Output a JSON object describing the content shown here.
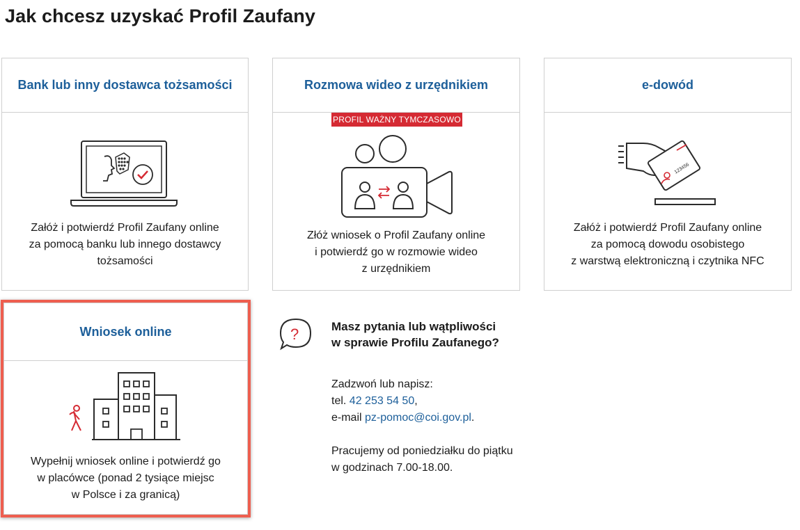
{
  "page": {
    "title": "Jak chcesz uzyskać Profil Zaufany"
  },
  "cards": [
    {
      "title": "Bank lub inny dostawca tożsamości",
      "description": [
        "Załóż i potwierdź Profil Zaufany online",
        "za pomocą banku lub innego dostawcy",
        "tożsamości"
      ],
      "icon": "laptop-identity-icon"
    },
    {
      "title": "Rozmowa wideo z urzędnikiem",
      "badge": "PROFIL WAŻNY TYMCZASOWO",
      "description": [
        "Złóż wniosek o Profil Zaufany online",
        "i potwierdź go w rozmowie wideo",
        "z urzędnikiem"
      ],
      "icon": "video-call-icon"
    },
    {
      "title": "e-dowód",
      "description": [
        "Załóż i potwierdź Profil Zaufany online",
        "za pomocą dowodu osobistego",
        "z warstwą elektroniczną i czytnika NFC"
      ],
      "icon": "id-card-reader-icon",
      "card_number": "123456"
    },
    {
      "title": "Wniosek online",
      "description": [
        "Wypełnij wniosek online i potwierdź go",
        "w placówce (ponad 2 tysiące miejsc",
        "w Polsce i za granicą)"
      ],
      "icon": "office-building-icon"
    }
  ],
  "help": {
    "question": [
      "Masz pytania lub wątpliwości",
      "w sprawie Profilu Zaufanego?"
    ],
    "contact_intro": "Zadzwoń lub napisz:",
    "phone_prefix": "tel. ",
    "phone": "42 253 54 50",
    "phone_suffix": ",",
    "email_prefix": "e-mail ",
    "email": "pz-pomoc@coi.gov.pl",
    "email_suffix": ".",
    "hours": [
      "Pracujemy od poniedziałku do piątku",
      "w godzinach 7.00-18.00."
    ]
  },
  "colors": {
    "link": "#1d5f9a",
    "accent_red": "#d52a33",
    "highlight": "#ee5e4f",
    "border": "#cfcfcf"
  }
}
